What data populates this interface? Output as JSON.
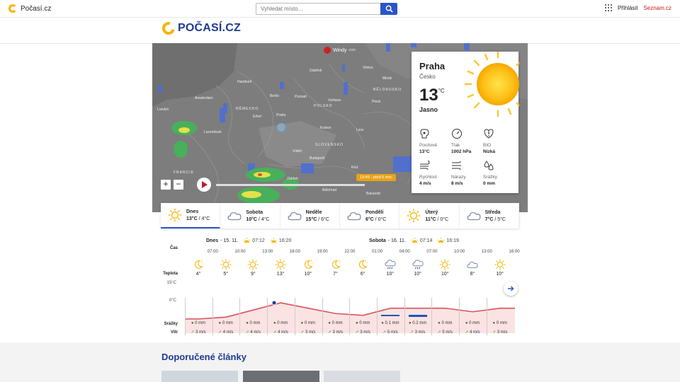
{
  "topbar": {
    "logo_text": "Počasí.cz",
    "search_placeholder": "Vyhledat místo...",
    "login_label": "Přihlásit",
    "seznam_label": "Seznam.cz"
  },
  "brand": {
    "text": "POČASÍ.CZ"
  },
  "map": {
    "provider": "Windy",
    "provider_suffix": "com",
    "timestamp": "13:45 - před 5 min.",
    "zoom_in": "+",
    "zoom_out": "−",
    "cities": [
      "Hamburk",
      "Berlín",
      "Poznaň",
      "Gdaňsk",
      "Vilnius",
      "Minsk",
      "Amsterdam",
      "Londýn",
      "Lucemburk",
      "Erfurt",
      "Praha",
      "Varšava",
      "Pinsk",
      "Krakov",
      "Lvov",
      "Vídeň",
      "Budapešť",
      "Kluž",
      "Záhřeb",
      "Bělehrad",
      "Bukurešť",
      "NĚMECKO",
      "POLSKO",
      "BĚLORUSKO",
      "FRANCIE",
      "SLOVENSKO"
    ]
  },
  "current": {
    "city": "Praha",
    "country": "Česko",
    "temp": "13",
    "unit": "°C",
    "condition": "Jasno",
    "stats": [
      {
        "label": "Pocitově",
        "value": "13°C",
        "icon": "feels-like-icon"
      },
      {
        "label": "Tlak",
        "value": "1002 hPa",
        "icon": "pressure-gauge-icon"
      },
      {
        "label": "BIO",
        "value": "Nízká",
        "icon": "bio-icon"
      },
      {
        "label": "Rychlost",
        "value": "4 m/s",
        "icon": "wind-speed-icon"
      },
      {
        "label": "Nárazy",
        "value": "8 m/s",
        "icon": "wind-gust-icon"
      },
      {
        "label": "Srážky",
        "value": "0 mm",
        "icon": "precipitation-icon"
      }
    ]
  },
  "days": [
    {
      "name": "Dnes",
      "max": "13°C",
      "min": "4°C",
      "icon": "sun-icon"
    },
    {
      "name": "Sobota",
      "max": "10°C",
      "min": "4°C",
      "icon": "cloud-icon"
    },
    {
      "name": "Neděle",
      "max": "15°C",
      "min": "6°C",
      "icon": "cloud-icon"
    },
    {
      "name": "Pondělí",
      "max": "6°C",
      "min": "0°C",
      "icon": "cloud-icon"
    },
    {
      "name": "Úterý",
      "max": "11°C",
      "min": "0°C",
      "icon": "sun-icon"
    },
    {
      "name": "Středa",
      "max": "7°C",
      "min": "5°C",
      "icon": "cloud-icon"
    }
  ],
  "forecast": {
    "row_labels": {
      "time": "Čas",
      "temp": "Teplota",
      "rain": "Srážky",
      "wind": "Vítr"
    },
    "scale_high": "15°C",
    "scale_low": "0°C",
    "date1": {
      "label": "Dnes",
      "date": "- 15. 11.",
      "sunrise": "07:12",
      "sunset": "16:20"
    },
    "date2": {
      "label": "Sobota",
      "date": "- 16. 11.",
      "sunrise": "07:14",
      "sunset": "16:19"
    },
    "hours": [
      "07:00",
      "10:00",
      "13:00",
      "16:00",
      "19:00",
      "22:00",
      "01:00",
      "04:00",
      "07:00",
      "10:00",
      "13:00",
      "16:00"
    ],
    "columns": [
      {
        "icon": "moon-icon",
        "temp": "4°",
        "rain": "0 mm",
        "wind": "3 m/s",
        "rain_mm": 0,
        "temp_c": 4
      },
      {
        "icon": "sun-icon",
        "temp": "5°",
        "rain": "0 mm",
        "wind": "4 m/s",
        "rain_mm": 0,
        "temp_c": 5
      },
      {
        "icon": "sun-icon",
        "temp": "9°",
        "rain": "0 mm",
        "wind": "4 m/s",
        "rain_mm": 0,
        "temp_c": 9
      },
      {
        "icon": "sun-icon",
        "temp": "13°",
        "rain": "0 mm",
        "wind": "4 m/s",
        "rain_mm": 0,
        "temp_c": 13
      },
      {
        "icon": "moon-icon",
        "temp": "10°",
        "rain": "0 mm",
        "wind": "3 m/s",
        "rain_mm": 0,
        "temp_c": 10
      },
      {
        "icon": "moon-icon",
        "temp": "7°",
        "rain": "0 mm",
        "wind": "3 m/s",
        "rain_mm": 0,
        "temp_c": 7
      },
      {
        "icon": "moon-icon",
        "temp": "6°",
        "rain": "0 mm",
        "wind": "3 m/s",
        "rain_mm": 0,
        "temp_c": 6
      },
      {
        "icon": "rain-icon",
        "temp": "10°",
        "rain": "0.1 mm",
        "wind": "5 m/s",
        "rain_mm": 0.1,
        "temp_c": 10
      },
      {
        "icon": "rain-icon",
        "temp": "10°",
        "rain": "0.2 mm",
        "wind": "3 m/s",
        "rain_mm": 0.2,
        "temp_c": 10
      },
      {
        "icon": "sun-icon",
        "temp": "10°",
        "rain": "0 mm",
        "wind": "5 m/s",
        "rain_mm": 0,
        "temp_c": 10
      },
      {
        "icon": "cloud-icon",
        "temp": "8°",
        "rain": "0 mm",
        "wind": "4 m/s",
        "rain_mm": 0,
        "temp_c": 8
      },
      {
        "icon": "sun-icon",
        "temp": "10°",
        "rain": "0 mm",
        "wind": "3 m/s",
        "rain_mm": 0,
        "temp_c": 10
      }
    ]
  },
  "articles": {
    "title": "Doporučené články"
  }
}
